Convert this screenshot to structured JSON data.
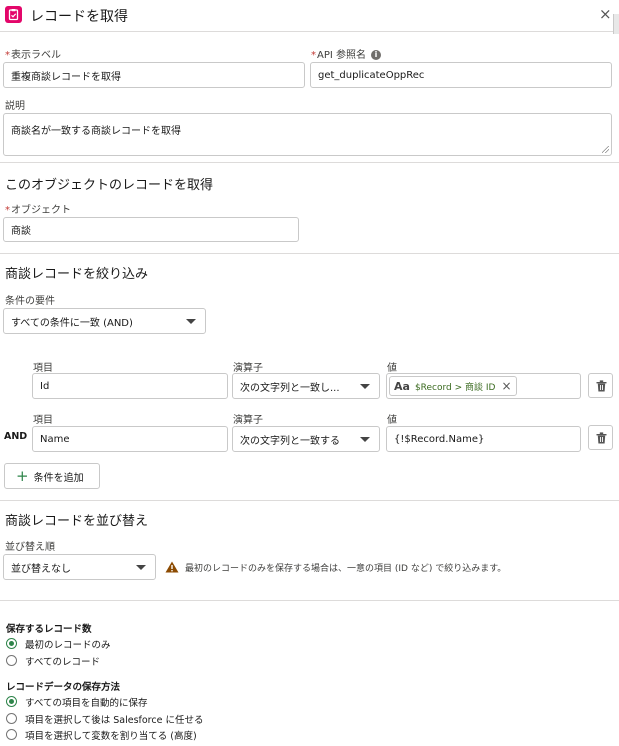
{
  "header": {
    "title": "レコードを取得",
    "close_symbol": "×"
  },
  "fields": {
    "label": {
      "label": "表示ラベル",
      "value": "重複商談レコードを取得"
    },
    "api_name": {
      "label": "API 参照名",
      "value": "get_duplicateOppRec"
    },
    "description": {
      "label": "説明",
      "value": "商談名が一致する商談レコードを取得"
    }
  },
  "object_section": {
    "title": "このオブジェクトのレコードを取得",
    "label": "オブジェクト",
    "value": "商談"
  },
  "filter_section": {
    "title": "商談レコードを絞り込み",
    "condition_label": "条件の要件",
    "condition_value": "すべての条件に一致 (AND)",
    "field_header": "項目",
    "operator_header": "演算子",
    "value_header": "値",
    "rows": [
      {
        "prefix": "",
        "field": "Id",
        "operator": "次の文字列と一致し...",
        "pill_icon": "Aa",
        "pill_text": "$Record > 商談 ID",
        "pill_close": "×"
      },
      {
        "prefix": "AND",
        "field": "Name",
        "operator": "次の文字列と一致する",
        "value": "{!$Record.Name}"
      }
    ],
    "add_button": "条件を追加"
  },
  "sort_section": {
    "title": "商談レコードを並び替え",
    "sort_label": "並び替え順",
    "sort_value": "並び替えなし",
    "warning": "最初のレコードのみを保存する場合は、一意の項目 (ID など) で絞り込みます。"
  },
  "store_count": {
    "title": "保存するレコード数",
    "options": [
      {
        "label": "最初のレコードのみ",
        "selected": true
      },
      {
        "label": "すべてのレコード",
        "selected": false
      }
    ]
  },
  "store_method": {
    "title": "レコードデータの保存方法",
    "options": [
      {
        "label": "すべての項目を自動的に保存",
        "selected": true
      },
      {
        "label": "項目を選択して後は Salesforce に任せる",
        "selected": false
      },
      {
        "label": "項目を選択して変数を割り当てる (高度)",
        "selected": false
      }
    ]
  },
  "colors": {
    "accent": "#e3066a",
    "required": "#c23934",
    "radio_selected": "#2e844a",
    "warning": "#8c4b02"
  }
}
